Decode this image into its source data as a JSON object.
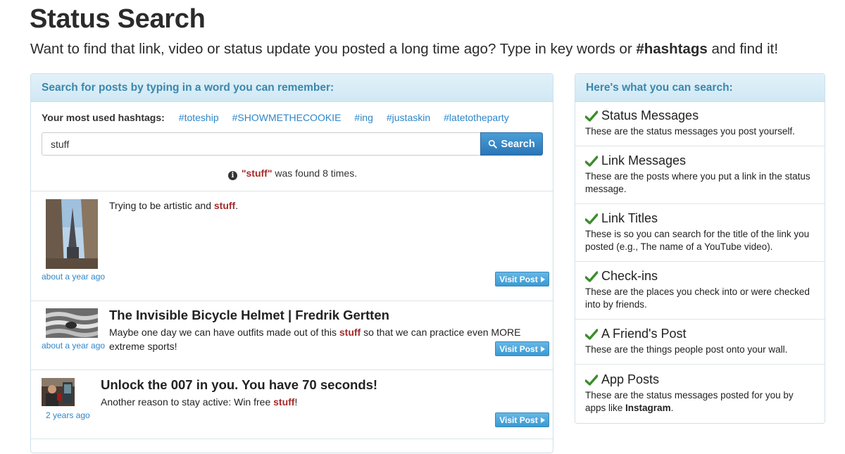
{
  "header": {
    "title": "Status Search",
    "subtitle_prefix": "Want to find that link, video or status update you posted a long time ago? Type in key words or ",
    "subtitle_bold": "#hashtags",
    "subtitle_suffix": " and find it!"
  },
  "search_panel": {
    "heading": "Search for posts by typing in a word you can remember:",
    "hashtags_label": "Your most used hashtags:",
    "hashtags": [
      "#toteship",
      "#SHOWMETHECOOKIE",
      "#ing",
      "#justaskin",
      "#latetotheparty"
    ],
    "search_value": "stuff",
    "search_button_label": "Search",
    "result_term": "\"stuff\"",
    "result_suffix": " was found 8 times."
  },
  "posts": [
    {
      "title": "",
      "text_before": "Trying to be artistic and ",
      "highlight": "stuff",
      "text_after": ".",
      "time": "about a year ago",
      "button": "Visit Post"
    },
    {
      "title": "The Invisible Bicycle Helmet | Fredrik Gertten",
      "text_before": "Maybe one day we can have outfits made out of this ",
      "highlight": "stuff",
      "text_after": " so that we can practice even MORE extreme sports!",
      "time": "about a year ago",
      "button": "Visit Post"
    },
    {
      "title": "Unlock the 007 in you. You have 70 seconds!",
      "text_before": "Another reason to stay active: Win free ",
      "highlight": "stuff",
      "text_after": "!",
      "time": "2 years ago",
      "button": "Visit Post"
    }
  ],
  "features_panel": {
    "heading": "Here's what you can search:",
    "items": [
      {
        "title": "Status Messages",
        "desc": "These are the status messages you post yourself."
      },
      {
        "title": "Link Messages",
        "desc": "These are the posts where you put a link in the status message."
      },
      {
        "title": "Link Titles",
        "desc": "These is so you can search for the title of the link you posted (e.g., The name of a YouTube video)."
      },
      {
        "title": "Check-ins",
        "desc": "These are the places you check into or were checked into by friends."
      },
      {
        "title": "A Friend's Post",
        "desc": "These are the things people post onto your wall."
      },
      {
        "title": "App Posts",
        "desc_prefix": "These are the status messages posted for you by apps like ",
        "desc_bold": "Instagram",
        "desc_suffix": "."
      }
    ]
  },
  "colors": {
    "accent_link": "#2f86c8",
    "panel_heading": "#3a87ad",
    "highlight": "#a52a2a",
    "check": "#3d8c2e"
  },
  "icons": {
    "search": "search-icon",
    "info": "info-icon",
    "check": "check-icon",
    "play": "play-arrow-icon"
  }
}
